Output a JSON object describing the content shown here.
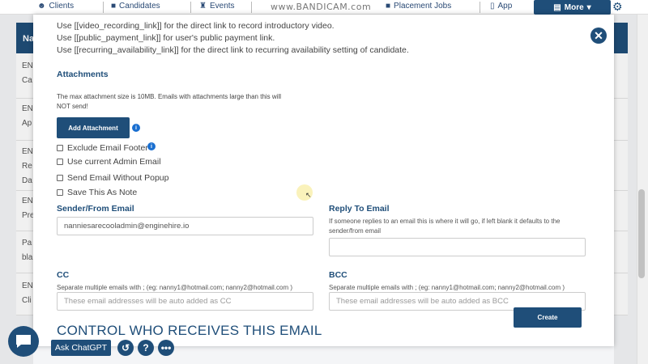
{
  "topnav": {
    "items": [
      {
        "label": "Clients",
        "icon": "clients-icon"
      },
      {
        "label": "Candidates",
        "icon": "briefcase-icon"
      },
      {
        "label": "Events",
        "icon": "trophy-icon"
      },
      {
        "label": "Placement Jobs",
        "icon": "briefcase-icon"
      },
      {
        "label": "App",
        "icon": "phone-icon"
      }
    ],
    "more_label": "More",
    "watermark": "www.BANDICAM.com"
  },
  "background": {
    "header_label": "Na",
    "rows": [
      {
        "line1": "EN",
        "line2": "Ca"
      },
      {
        "line1": "EN",
        "line2": "Ap"
      },
      {
        "line1": "EN",
        "line2": "Re",
        "line3": "Da"
      },
      {
        "line1": "EN",
        "line2": "Pre"
      },
      {
        "line1": "Pa",
        "line2": "bla"
      },
      {
        "line1": "EN",
        "line2": "Cli"
      }
    ]
  },
  "modal": {
    "instructions": [
      "Use [[video_recording_link]] for the direct link to record introductory video.",
      "Use [[public_payment_link]] for user's public payment link.",
      "Use [[recurring_availability_link]] for the direct link to recurring availability setting of candidate."
    ],
    "attachments": {
      "title": "Attachments",
      "note": "The max attachment size is 10MB. Emails with attachments large than this will NOT send!",
      "button_label": "Add Attachment"
    },
    "checkboxes": [
      {
        "label": "Exclude Email Footer",
        "checked": false
      },
      {
        "label": "Use current Admin Email",
        "checked": false
      },
      {
        "label": "Send Email Without Popup",
        "checked": false
      },
      {
        "label": "Save This As Note",
        "checked": false
      }
    ],
    "sender": {
      "label": "Sender/From Email",
      "value": "nanniesarecooladmin@enginehire.io"
    },
    "reply_to": {
      "label": "Reply To Email",
      "help": "If someone replies to an email this is where it will go, if left blank it defaults to the sender/from email",
      "value": ""
    },
    "cc": {
      "label": "CC",
      "help": "Separate multiple emails with ; (eg: nanny1@hotmail.com; nanny2@hotmail.com )",
      "placeholder": "These email addresses will be auto added as CC"
    },
    "bcc": {
      "label": "BCC",
      "help": "Separate multiple emails with ; (eg: nanny1@hotmail.com; nanny2@hotmail.com )",
      "placeholder": "These email addresses will be auto added as BCC"
    },
    "create_label": "Create",
    "section_heading": "CONTROL WHO RECEIVES THIS EMAIL"
  },
  "widgets": {
    "ask_label": "Ask ChatGPT"
  },
  "colors": {
    "primary": "#1f4e79",
    "info": "#1a6fd0"
  }
}
